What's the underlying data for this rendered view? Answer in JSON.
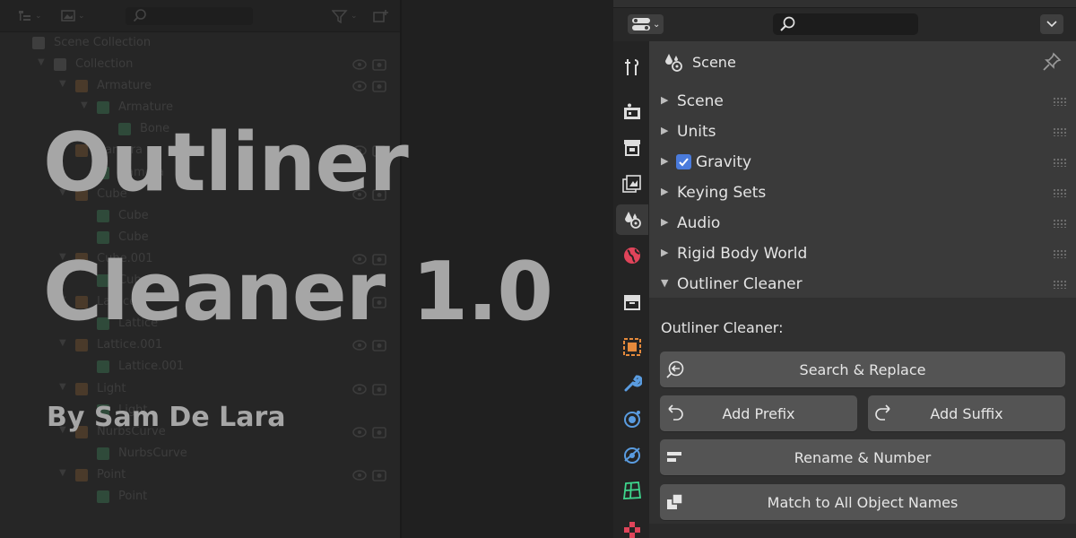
{
  "outliner": {
    "rows": [
      {
        "label": "Scene Collection",
        "indent": 0,
        "icon": "collection",
        "tri": ""
      },
      {
        "label": "Collection",
        "indent": 1,
        "icon": "collection",
        "tri": "▼"
      },
      {
        "label": "Armature",
        "indent": 2,
        "icon": "armature",
        "tri": "▼"
      },
      {
        "label": "Armature",
        "indent": 3,
        "icon": "armature-data",
        "tri": "▼"
      },
      {
        "label": "Bone",
        "indent": 4,
        "icon": "bone",
        "tri": ""
      },
      {
        "label": "Camera",
        "indent": 2,
        "icon": "camera",
        "tri": "▼"
      },
      {
        "label": "Camera",
        "indent": 3,
        "icon": "camera-data",
        "tri": ""
      },
      {
        "label": "Cube",
        "indent": 2,
        "icon": "cube",
        "tri": "▼"
      },
      {
        "label": "Cube",
        "indent": 3,
        "icon": "mesh",
        "tri": ""
      },
      {
        "label": "Cube",
        "indent": 3,
        "icon": "mesh",
        "tri": ""
      },
      {
        "label": "Cube.001",
        "indent": 2,
        "icon": "cube",
        "tri": "▼"
      },
      {
        "label": "Cube",
        "indent": 3,
        "icon": "mesh",
        "tri": ""
      },
      {
        "label": "Lattice",
        "indent": 2,
        "icon": "lattice",
        "tri": "▼"
      },
      {
        "label": "Lattice",
        "indent": 3,
        "icon": "lattice-data",
        "tri": ""
      },
      {
        "label": "Lattice.001",
        "indent": 2,
        "icon": "lattice",
        "tri": "▼"
      },
      {
        "label": "Lattice.001",
        "indent": 3,
        "icon": "lattice-data",
        "tri": ""
      },
      {
        "label": "Light",
        "indent": 2,
        "icon": "light",
        "tri": "▼"
      },
      {
        "label": "Light",
        "indent": 3,
        "icon": "light-data",
        "tri": ""
      },
      {
        "label": "NurbsCurve",
        "indent": 2,
        "icon": "curve",
        "tri": "▼"
      },
      {
        "label": "NurbsCurve",
        "indent": 3,
        "icon": "curve-data",
        "tri": ""
      },
      {
        "label": "Point",
        "indent": 2,
        "icon": "light",
        "tri": "▼"
      },
      {
        "label": "Point",
        "indent": 3,
        "icon": "light-data",
        "tri": ""
      }
    ]
  },
  "overlay": {
    "title_line1": "Outliner",
    "title_line2": "Cleaner 1.0",
    "byline": "By Sam De Lara"
  },
  "properties": {
    "context_label": "Scene",
    "panels": [
      {
        "label": "Scene",
        "expanded": false,
        "checkbox": false
      },
      {
        "label": "Units",
        "expanded": false,
        "checkbox": false
      },
      {
        "label": "Gravity",
        "expanded": false,
        "checkbox": true
      },
      {
        "label": "Keying Sets",
        "expanded": false,
        "checkbox": false
      },
      {
        "label": "Audio",
        "expanded": false,
        "checkbox": false
      },
      {
        "label": "Rigid Body World",
        "expanded": false,
        "checkbox": false
      },
      {
        "label": "Outliner Cleaner",
        "expanded": true,
        "checkbox": false
      }
    ],
    "cleaner": {
      "heading": "Outliner Cleaner:",
      "search_replace": "Search & Replace",
      "add_prefix": "Add Prefix",
      "add_suffix": "Add Suffix",
      "rename_number": "Rename & Number",
      "match_names": "Match to All Object Names"
    },
    "tabs": [
      "tool",
      "render",
      "output",
      "view-layer",
      "scene",
      "world",
      "collection",
      "object",
      "modifiers",
      "particles",
      "physics",
      "constraints",
      "data",
      "texture"
    ]
  },
  "colors": {
    "accent_blue": "#4a7bdc",
    "title_gray": "#a6a6a6",
    "button": "#545454",
    "panel": "#3a3a3a"
  }
}
